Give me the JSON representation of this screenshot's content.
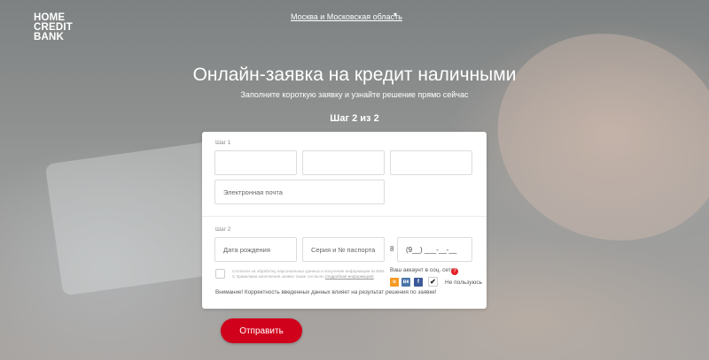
{
  "logo": {
    "lines": [
      "HOME",
      "CREDIT",
      "BANK"
    ]
  },
  "header": {
    "region": "Москва и Московская область",
    "region_caret": "▾"
  },
  "hero": {
    "title": "Онлайн-заявка на кредит наличными",
    "subtitle": "Заполните короткую заявку и узнайте решение прямо сейчас",
    "step": "Шаг 2 из 2"
  },
  "form": {
    "step1": {
      "label": "Шаг 1",
      "field1": "",
      "field2": "",
      "field3": "",
      "email_placeholder": "Электронная почта"
    },
    "step2": {
      "label": "Шаг 2",
      "birthdate_placeholder": "Дата рождения",
      "passport_placeholder": "Серия и № паспорта",
      "phone_prefix": "8",
      "phone_mask": "(9__) ___-__-__"
    },
    "consent": {
      "line1": "Согласен на обработку персональных данных и получение информации из БКИ.",
      "line2": "С правилами заполнения заявки также согласен",
      "link": "(подробная информация)"
    },
    "social": {
      "label": "Ваш аккаунт в соц. сетях",
      "help": "?",
      "ok": "о",
      "vk": "вк",
      "fb": "f",
      "none_mark": "✔",
      "none_label": "Не пользуюсь"
    },
    "warning": "Внимание! Корректность введенных данных влияет на результат решения по заявке!"
  },
  "submit_label": "Отправить"
}
